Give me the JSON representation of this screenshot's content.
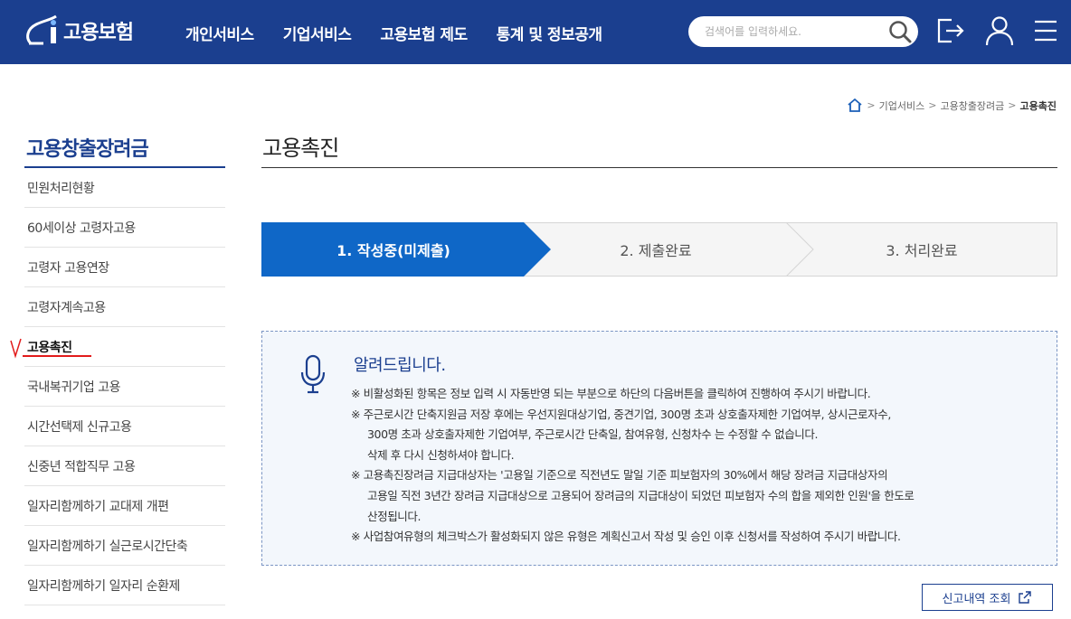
{
  "header": {
    "logo_text": "고용보험",
    "nav": [
      "개인서비스",
      "기업서비스",
      "고용보험 제도",
      "통계 및 정보공개"
    ],
    "search_placeholder": "검색어를 입력하세요.",
    "icons": [
      "search-icon",
      "logout-icon",
      "user-icon",
      "menu-icon"
    ],
    "bg_color": "#1b3f8f"
  },
  "breadcrumb": {
    "items": [
      "기업서비스",
      "고용창출장려금"
    ],
    "current": "고용촉진"
  },
  "lnb": {
    "title": "고용창출장려금",
    "items": [
      "민원처리현황",
      "60세이상 고령자고용",
      "고령자 고용연장",
      "고령자계속고용",
      "고용촉진",
      "국내복귀기업 고용",
      "시간선택제 신규고용",
      "신중년 적합직무 고용",
      "일자리함께하기 교대제 개편",
      "일자리함께하기 실근로시간단축",
      "일자리함께하기 일자리 순환제"
    ],
    "active_index": 4
  },
  "main": {
    "title": "고용촉진",
    "steps": [
      "1. 작성중(미제출)",
      "2. 제출완료",
      "3. 처리완료"
    ],
    "active_step_color": "#0f67c7",
    "notice": {
      "title": "알려드립니다.",
      "lines": [
        "※ 비활성화된 항목은 정보 입력 시 자동반영 되는 부분으로 하단의 다음버튼을 클릭하여 진행하여 주시기 바랍니다.",
        "※ 주근로시간 단축지원금 저장 후에는 우선지원대상기업, 중견기업, 300명 초과 상호출자제한 기업여부, 상시근로자수,",
        "300명 초과 상호출자제한 기업여부, 주근로시간 단축일, 참여유형, 신청차수 는 수정할 수 없습니다.",
        "삭제 후 다시 신청하셔야 합니다.",
        "※ 고용촉진장려금 지급대상자는 '고용일 기준으로 직전년도 말일 기준 피보험자의 30%에서 해당 장려금 지급대상자의",
        "고용일 직전 3년간 장려금 지급대상으로 고용되어 장려금의 지급대상이 되었던 피보험자 수의 합을 제외한 인원'을 한도로",
        "산정됩니다.",
        "※ 사업참여유형의 체크박스가 활성화되지 않은 유형은 계획신고서 작성 및 승인 이후 신청서를 작성하여 주시기 바랍니다."
      ]
    },
    "history_button": "신고내역 조회"
  }
}
